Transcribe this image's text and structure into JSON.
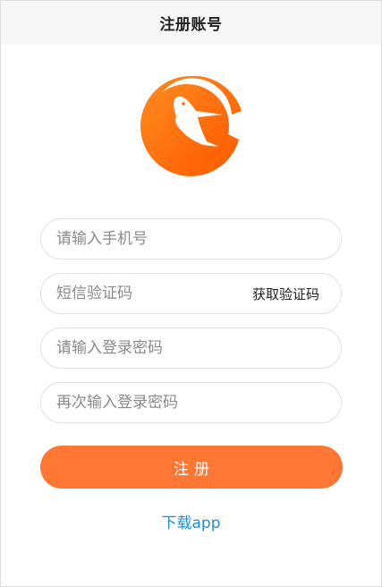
{
  "header": {
    "title": "注册账号"
  },
  "logo": {
    "icon": "hummingbird-logo",
    "colors": {
      "primary": "#ff6a00",
      "secondary": "#ff8c1a"
    }
  },
  "form": {
    "phone": {
      "placeholder": "请输入手机号",
      "value": ""
    },
    "sms_code": {
      "placeholder": "短信验证码",
      "value": "",
      "get_code_label": "获取验证码"
    },
    "password": {
      "placeholder": "请输入登录密码",
      "value": ""
    },
    "confirm_password": {
      "placeholder": "再次输入登录密码",
      "value": ""
    }
  },
  "register_button": {
    "label": "注册",
    "color": "#ff7732"
  },
  "download_link": {
    "label": "下载app",
    "color": "#1a8fd6"
  }
}
